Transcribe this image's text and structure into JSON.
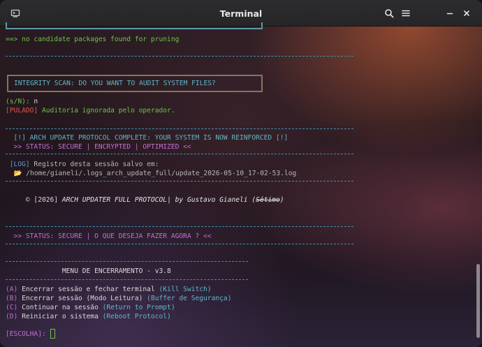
{
  "window": {
    "title": "Terminal"
  },
  "icons": {
    "new_tab": "terminal-icon",
    "search": "search-icon",
    "menu": "hamburger-menu-icon",
    "minimize": "minimize-icon",
    "close": "close-icon"
  },
  "colors": {
    "green": "#6cc44a",
    "cyan": "#5fb7c8",
    "red": "#e4574d",
    "magenta": "#c46fd6",
    "rule": "#3f8fb3"
  },
  "terminal": {
    "prune": {
      "arrow": "==>",
      "text": " no candidate packages found for pruning"
    },
    "integrity_prompt": "INTEGRITY SCAN: DO YOU WANT TO AUDIT SYSTEM FILES?",
    "yn_prompt": "(s/N):",
    "yn_answer": " n",
    "skipped_tag": "[PULADO]",
    "skipped_text": " Auditoria ignorada pelo operador.",
    "complete_line": "  [!] ARCH UPDATE PROTOCOL COMPLETE: YOUR SYSTEM IS NOW REINFORCED [!]",
    "status_line": "  >> STATUS: SECURE | ENCRYPTED | OPTIMIZED <<",
    "log_tag": " [LOG]",
    "log_text": " Registro desta sessão salvo em:",
    "log_path_icon": "  📂",
    "log_path": " /home/gianeli/.logs_arch_update_full/update_2026-05-10_17-02-53.log",
    "credit_prefix": "     © [2026] ",
    "credit_title": "ARCH UPDATER FULL PROTOCOL",
    "credit_by": "| by Gustavo Gianeli (",
    "credit_sig": "Sétimo",
    "credit_end": ")",
    "status2": "  >> STATUS: SECURE | O QUE DESEJA FAZER AGORA ? <<",
    "menu_title": "              MENU DE ENCERRAMENTO - v3.8",
    "options": [
      {
        "key": "(A)",
        "text": " Encerrar sessão e fechar terminal ",
        "hint": "(Kill Switch)"
      },
      {
        "key": "(B)",
        "text": " Encerrar sessão (Modo Leitura) ",
        "hint": "(Buffer de Segurança)"
      },
      {
        "key": "(C)",
        "text": " Continuar na sessão ",
        "hint": "(Return to Prompt)"
      },
      {
        "key": "(D)",
        "text": " Reiniciar o sistema ",
        "hint": "(Reboot Protocol)"
      }
    ],
    "choice_prompt": "[ESCOLHA]:"
  }
}
